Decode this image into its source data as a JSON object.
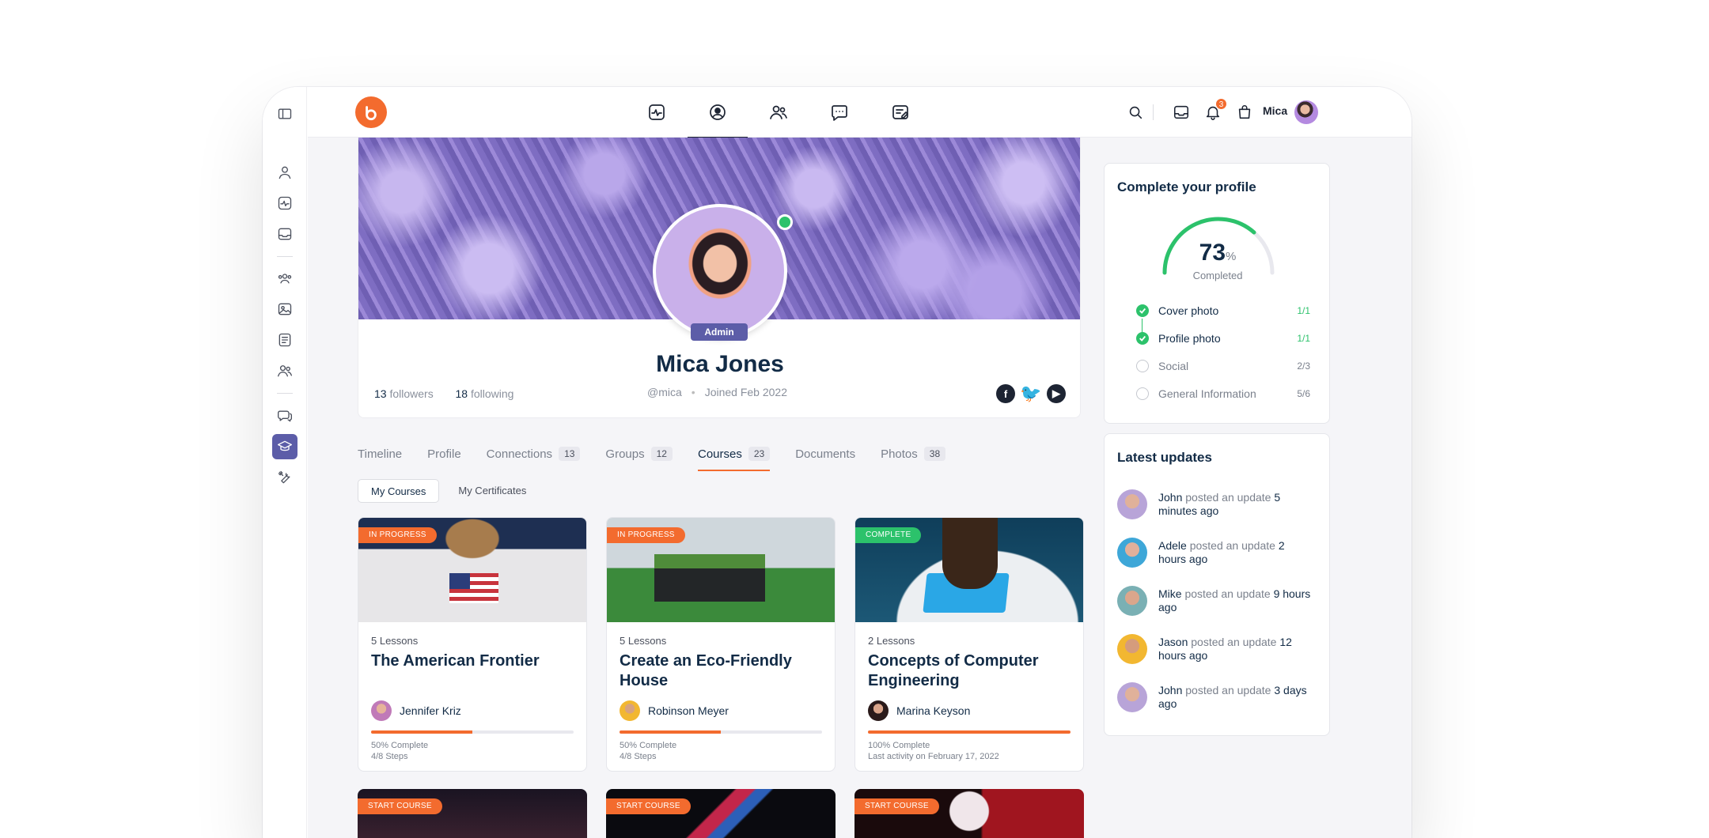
{
  "topbar": {
    "user_name": "Mica",
    "notification_count": "3"
  },
  "profile": {
    "name": "Mica Jones",
    "role_badge": "Admin",
    "handle": "@mica",
    "joined": "Joined Feb 2022",
    "followers_count": "13",
    "followers_label": "followers",
    "following_count": "18",
    "following_label": "following"
  },
  "tabs": [
    {
      "label": "Timeline",
      "count": ""
    },
    {
      "label": "Profile",
      "count": ""
    },
    {
      "label": "Connections",
      "count": "13"
    },
    {
      "label": "Groups",
      "count": "12"
    },
    {
      "label": "Courses",
      "count": "23"
    },
    {
      "label": "Documents",
      "count": ""
    },
    {
      "label": "Photos",
      "count": "38"
    }
  ],
  "subtabs": [
    "My Courses",
    "My Certificates"
  ],
  "courses": [
    {
      "tag": "IN PROGRESS",
      "lessons": "5 Lessons",
      "title": "The American Frontier",
      "instructor": "Jennifer Kriz",
      "progress": 50,
      "status": "50% Complete",
      "detail": "4/8 Steps"
    },
    {
      "tag": "IN PROGRESS",
      "lessons": "5 Lessons",
      "title": "Create an Eco-Friendly House",
      "instructor": "Robinson Meyer",
      "progress": 50,
      "status": "50% Complete",
      "detail": "4/8 Steps"
    },
    {
      "tag": "COMPLETE",
      "lessons": "2 Lessons",
      "title": "Concepts of Computer Engineering",
      "instructor": "Marina Keyson",
      "progress": 100,
      "status": "100% Complete",
      "detail": "Last activity on February 17, 2022"
    }
  ],
  "more_courses": [
    {
      "tag": "START COURSE"
    },
    {
      "tag": "START COURSE"
    },
    {
      "tag": "START COURSE"
    }
  ],
  "complete_profile": {
    "title": "Complete your profile",
    "percent": "73",
    "percent_sign": "%",
    "percent_value": 73,
    "sub": "Completed",
    "items": [
      {
        "label": "Cover photo",
        "fraction": "1/1",
        "done": true
      },
      {
        "label": "Profile photo",
        "fraction": "1/1",
        "done": true
      },
      {
        "label": "Social",
        "fraction": "2/3",
        "done": false
      },
      {
        "label": "General Information",
        "fraction": "5/6",
        "done": false
      }
    ]
  },
  "latest_updates": {
    "title": "Latest updates",
    "items": [
      {
        "name": "John",
        "action": "posted an update",
        "time": "5 minutes ago"
      },
      {
        "name": "Adele",
        "action": "posted an update",
        "time": "2 hours ago"
      },
      {
        "name": "Mike",
        "action": "posted an update",
        "time": "9 hours ago"
      },
      {
        "name": "Jason",
        "action": "posted an update",
        "time": "12 hours ago"
      },
      {
        "name": "John",
        "action": "posted an update",
        "time": "3 days ago"
      }
    ]
  },
  "colors": {
    "accent": "#f36b2e",
    "success": "#2cc26b",
    "admin": "#5c5da8"
  }
}
